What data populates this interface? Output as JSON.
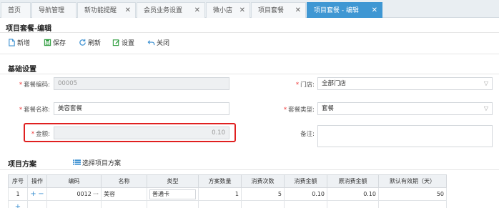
{
  "tabs": [
    {
      "label": "首页",
      "closable": false
    },
    {
      "label": "导航管理",
      "closable": false
    },
    {
      "label": "新功能提醒",
      "closable": true
    },
    {
      "label": "会员业务设置",
      "closable": true
    },
    {
      "label": "微小店",
      "closable": true
    },
    {
      "label": "项目套餐",
      "closable": true
    },
    {
      "label": "项目套餐 - 编辑",
      "closable": true,
      "active": true
    }
  ],
  "page_title": "项目套餐-编辑",
  "toolbar": {
    "new_label": "新增",
    "save_label": "保存",
    "refresh_label": "刷新",
    "settings_label": "设置",
    "close_label": "关闭"
  },
  "basic": {
    "section_title": "基础设置",
    "code_label": "套餐编码:",
    "code_value": "00005",
    "store_label": "门店:",
    "store_value": "全部门店",
    "name_label": "套餐名称:",
    "name_value": "美容套餐",
    "type_label": "套餐类型:",
    "type_value": "套餐",
    "amount_label": "金额:",
    "amount_value": "0.10",
    "note_label": "备注:",
    "note_value": ""
  },
  "plan": {
    "section_title": "项目方案",
    "choose_label": "选择项目方案",
    "columns": [
      "序号",
      "操作",
      "编码",
      "名称",
      "类型",
      "方案数量",
      "消费次数",
      "消费金额",
      "原消费金额",
      "默认有效期（天）"
    ],
    "rows": [
      {
        "seq": "1",
        "add": "+",
        "remove": "−",
        "code": "0012",
        "more": "···",
        "name": "美容",
        "type": "普通卡",
        "qty": "1",
        "times": "5",
        "amount": "0.10",
        "orig_amount": "0.10",
        "valid_days": "50"
      }
    ]
  },
  "colors": {
    "accent": "#3f97d3",
    "required": "#e33333",
    "highlight": "#e02020"
  }
}
